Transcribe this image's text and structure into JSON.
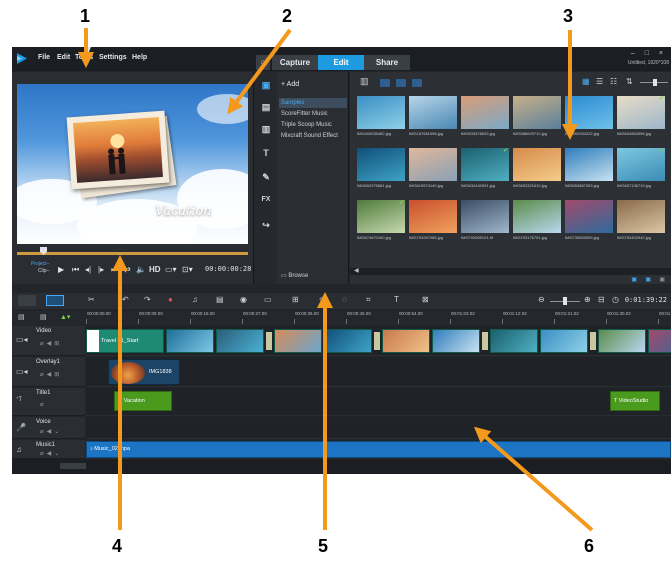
{
  "menu": [
    "File",
    "Edit",
    "Tools",
    "Settings",
    "Help"
  ],
  "mode_tabs": {
    "capture": "Capture",
    "edit": "Edit",
    "share": "Share"
  },
  "window": {
    "controls": "– □ ×",
    "project_info": "Untitled, 1920*108"
  },
  "preview": {
    "title_overlay": "Vacation",
    "project_label": "Project–",
    "clip_label": "Clip–",
    "hd_label": "HD",
    "timecode": "00:00:00:28"
  },
  "library": {
    "add_label": "Add",
    "folders": [
      "Samples",
      "ScoreFitter Music",
      "Triple Scoop Music",
      "Mixcraft Sound Effect"
    ],
    "browse_label": "Browse",
    "thumbnails": [
      {
        "name": "IMG404035482.jpg",
        "colors": [
          "#3a8fc4",
          "#8fd0e8"
        ],
        "check": false
      },
      {
        "name": "IMG187681598.jpg",
        "colors": [
          "#b7d6ea",
          "#4a87b2"
        ],
        "check": false
      },
      {
        "name": "IMG533578633.jpg",
        "colors": [
          "#d99c76",
          "#7aa9c9"
        ],
        "check": false
      },
      {
        "name": "IMG586629710.jpg",
        "colors": [
          "#c7b08a",
          "#5a7f9a"
        ],
        "check": false
      },
      {
        "name": "IMG592934222.jpg",
        "colors": [
          "#2b8ad0",
          "#6ec1ea"
        ],
        "check": false
      },
      {
        "name": "IMG604862696.jpg",
        "colors": [
          "#e9dcc6",
          "#9cb7c9"
        ],
        "check": true
      },
      {
        "name": "IMG602979681.jpg",
        "colors": [
          "#0f4f7a",
          "#3fa3c6"
        ],
        "check": false
      },
      {
        "name": "IMG619574140.jpg",
        "colors": [
          "#e0b79a",
          "#8aa0b5"
        ],
        "check": false
      },
      {
        "name": "IMG632440991.jpg",
        "colors": [
          "#1b5f6e",
          "#4fb0c2"
        ],
        "check": true
      },
      {
        "name": "IMG653321610.jpg",
        "colors": [
          "#d68a4a",
          "#f4cd8a"
        ],
        "check": false
      },
      {
        "name": "IMG653667053.jpg",
        "colors": [
          "#2f7dbb",
          "#c8e2f2"
        ],
        "check": false
      },
      {
        "name": "IMG657136719.jpg",
        "colors": [
          "#7ec7df",
          "#3a8cb6"
        ],
        "check": true
      },
      {
        "name": "IMG674670160.jpg",
        "colors": [
          "#4f7a3a",
          "#c7d9b0"
        ],
        "check": true
      },
      {
        "name": "IMG703267085.jpg",
        "colors": [
          "#c94f2d",
          "#f0a25e"
        ],
        "check": false
      },
      {
        "name": "IMG702909121.tif",
        "colors": [
          "#3b4d63",
          "#9fb7cc"
        ],
        "check": false
      },
      {
        "name": "IMG703176751.jpg",
        "colors": [
          "#5b8c4a",
          "#b9d7f0"
        ],
        "check": false
      },
      {
        "name": "IMG735659399.jpg",
        "colors": [
          "#a24a6c",
          "#2d6b9c"
        ],
        "check": false
      },
      {
        "name": "IMG763402942.jpg",
        "colors": [
          "#8a6a4a",
          "#dbc7a5"
        ],
        "check": false
      }
    ]
  },
  "timeline": {
    "timecode": "0:01:39:22",
    "ruler": [
      "00:00:00.00",
      "00:00:09.00",
      "00:00:18.00",
      "00:00:27.00",
      "00:00:36.00",
      "00:00:45.00",
      "00:00:54.00",
      "00:01:03.02",
      "00:01:12.02",
      "00:01:21.02",
      "00:01:30.02",
      "00:01"
    ],
    "tracks": [
      {
        "name": "Video",
        "icon": "video-track-icon"
      },
      {
        "name": "Overlay1",
        "icon": "overlay-track-icon"
      },
      {
        "name": "Title1",
        "icon": "title-track-icon"
      },
      {
        "name": "Voice",
        "icon": "voice-track-icon"
      },
      {
        "name": "Music1",
        "icon": "music-track-icon"
      }
    ],
    "clips": {
      "video_title": "Travel 01_Start",
      "overlay_label": "IMG1838",
      "title_left": "Vacation",
      "title_right": "VideoStudio",
      "music_label": "Music_02.mpa"
    }
  },
  "callouts": [
    "1",
    "2",
    "3",
    "4",
    "5",
    "6"
  ],
  "colors": {
    "accent": "#1e9be0",
    "title_clip": "#4a9a1e",
    "music_clip": "#1b74c4",
    "video_clip": "#1f8a73"
  }
}
